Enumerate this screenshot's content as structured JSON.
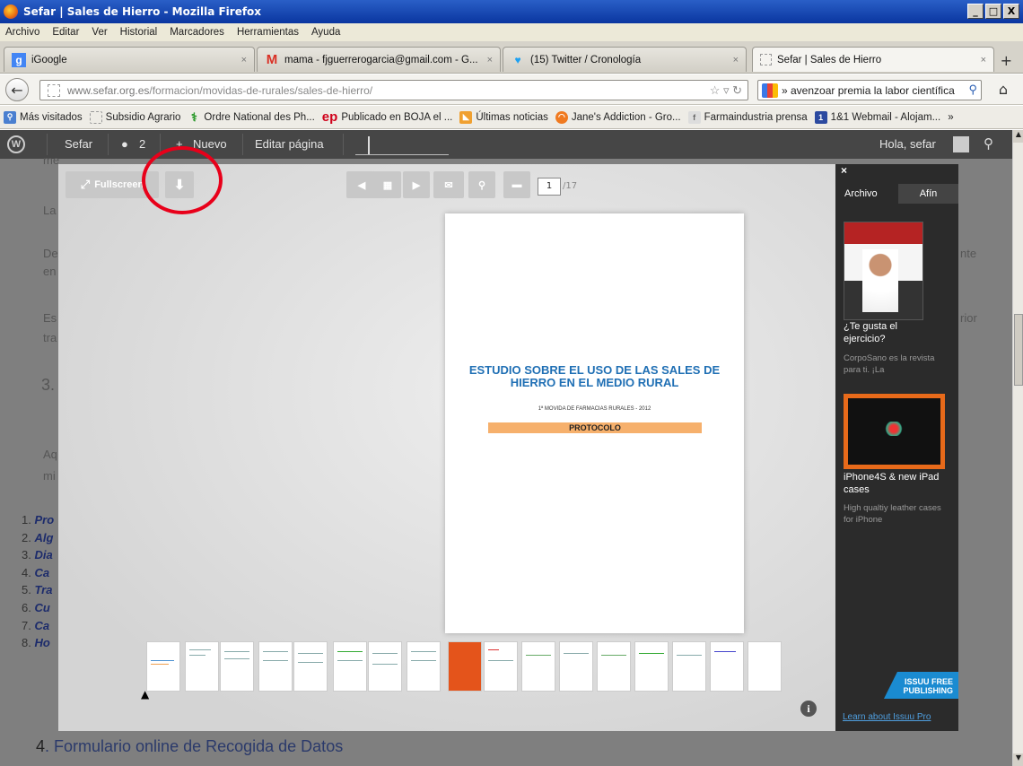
{
  "window": {
    "title": "Sefar | Sales de Hierro - Mozilla Firefox",
    "controls": [
      "_",
      "□",
      "X"
    ]
  },
  "menu": [
    "Archivo",
    "Editar",
    "Ver",
    "Historial",
    "Marcadores",
    "Herramientas",
    "Ayuda"
  ],
  "tabs": [
    {
      "label": "iGoogle",
      "active": false
    },
    {
      "label": "mama - fjguerrerogarcia@gmail.com - G...",
      "active": false
    },
    {
      "label": "(15) Twitter / Cronología",
      "active": false
    },
    {
      "label": "Sefar | Sales de Hierro",
      "active": true
    }
  ],
  "navbar": {
    "url_host": "www.sefar.org.es",
    "url_path": "/formacion/movidas-de-rurales/sales-de-hierro/",
    "search_value": "» avenzoar premia la labor científica"
  },
  "bookmarks": [
    "Más visitados",
    "Subsidio Agrario",
    "Ordre National des Ph...",
    "Publicado en BOJA el ...",
    "Últimas noticias",
    "Jane's Addiction - Gro...",
    "Farmaindustria prensa",
    "1&1 Webmail - Alojam..."
  ],
  "bookmark_ep": "ep",
  "wpbar": {
    "site": "Sefar",
    "comments": "2",
    "new": "Nuevo",
    "edit": "Editar página",
    "greeting": "Hola, sefar"
  },
  "page_bg": {
    "frag_me": "me",
    "frag_la": "La",
    "frag_de": "De",
    "frag_en": "en",
    "frag_es": "Es",
    "frag_tra": "tra",
    "frag_heading": "3.",
    "frag_aq": "Aq",
    "frag_mi": "mi",
    "frag_nte": "nte",
    "frag_rior": "rior",
    "list": [
      {
        "n": "1.",
        "t": "Pro"
      },
      {
        "n": "2.",
        "t": "Alg"
      },
      {
        "n": "3.",
        "t": "Dia"
      },
      {
        "n": "4.",
        "t": "Ca"
      },
      {
        "n": "5.",
        "t": "Tra"
      },
      {
        "n": "6.",
        "t": "Cu"
      },
      {
        "n": "7.",
        "t": "Ca"
      },
      {
        "n": "8.",
        "t": "Ho"
      }
    ],
    "h4_num": "4",
    "h4_text": ". Formulario online de Recogida de Datos"
  },
  "viewer": {
    "fullscreen": "Fullscreen",
    "page_current": "1",
    "page_total": "/17",
    "doc_title": "ESTUDIO SOBRE EL USO DE LAS SALES DE HIERRO EN EL MEDIO RURAL",
    "doc_subtitle": "1ª MOVIDA DE FARMACIAS RURALES  -  2012",
    "doc_band": "PROTOCOLO",
    "info": "i"
  },
  "adpanel": {
    "close": "×",
    "tab_archivo": "Archivo",
    "tab_afin": "Afín",
    "ad1_title": "¿Te gusta el ejercicio?",
    "ad1_desc": "CorpoSano es la revista para ti.  ¡La",
    "ad2_title": "iPhone4S & new iPad cases",
    "ad2_desc": "High qualtiy leather cases for iPhone",
    "badge": "ISSUU FREE PUBLISHING",
    "learn": "Learn about Issuu Pro"
  }
}
